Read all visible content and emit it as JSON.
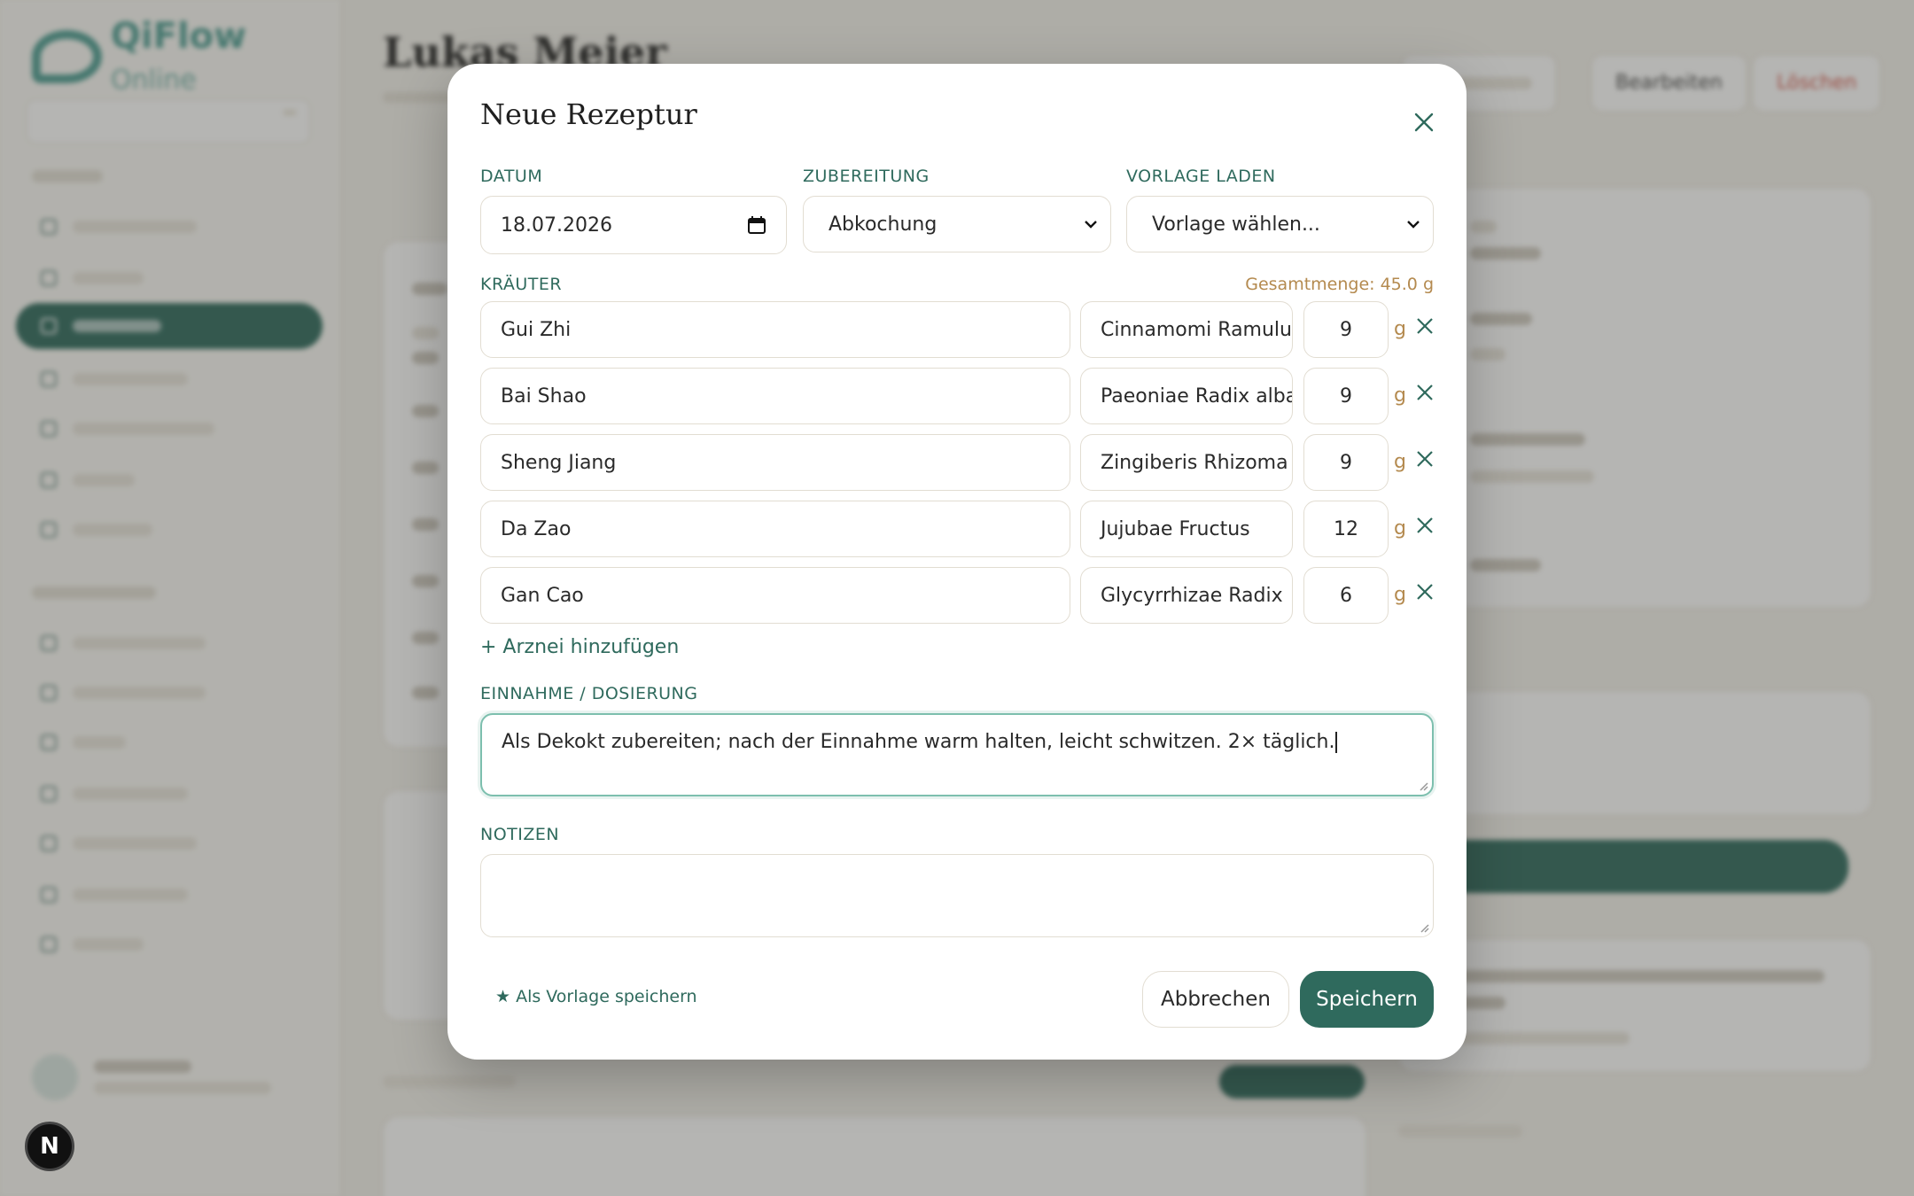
{
  "colors": {
    "accent": "#2f6a5d",
    "accent_light": "#7dbfae",
    "unit": "#b48a4f",
    "danger": "#d55a4e"
  },
  "background": {
    "logo": "QiFlow Online",
    "logo_main": "QiFlow",
    "logo_sub": "Online",
    "page_title": "Lukas Meier",
    "header_buttons": [
      "Bearbeiten",
      "Löschen"
    ]
  },
  "modal": {
    "title": "Neue Rezeptur",
    "date": {
      "label": "DATUM",
      "value": "18.07.2026"
    },
    "preparation": {
      "label": "ZUBEREITUNG",
      "value": "Abkochung"
    },
    "template": {
      "label": "VORLAGE LADEN",
      "value": "Vorlage wählen..."
    },
    "herbs_label": "KRÄUTER",
    "total": "Gesamtmenge: 45.0 g",
    "herbs": [
      {
        "name": "Gui Zhi",
        "latin": "Cinnamomi Ramulus",
        "qty": "9",
        "unit": "g"
      },
      {
        "name": "Bai Shao",
        "latin": "Paeoniae Radix alba",
        "qty": "9",
        "unit": "g"
      },
      {
        "name": "Sheng Jiang",
        "latin": "Zingiberis Rhizoma r",
        "qty": "9",
        "unit": "g"
      },
      {
        "name": "Da Zao",
        "latin": "Jujubae Fructus",
        "qty": "12",
        "unit": "g"
      },
      {
        "name": "Gan Cao",
        "latin": "Glycyrrhizae Radix",
        "qty": "6",
        "unit": "g"
      }
    ],
    "add_herb": "+ Arznei hinzufügen",
    "dosage": {
      "label": "EINNAHME / DOSIERUNG",
      "value": "Als Dekokt zubereiten; nach der Einnahme warm halten, leicht schwitzen. 2× täglich."
    },
    "notes": {
      "label": "NOTIZEN",
      "value": ""
    },
    "save_template": "★ Als Vorlage speichern",
    "cancel": "Abbrechen",
    "save": "Speichern"
  },
  "badge": "N"
}
